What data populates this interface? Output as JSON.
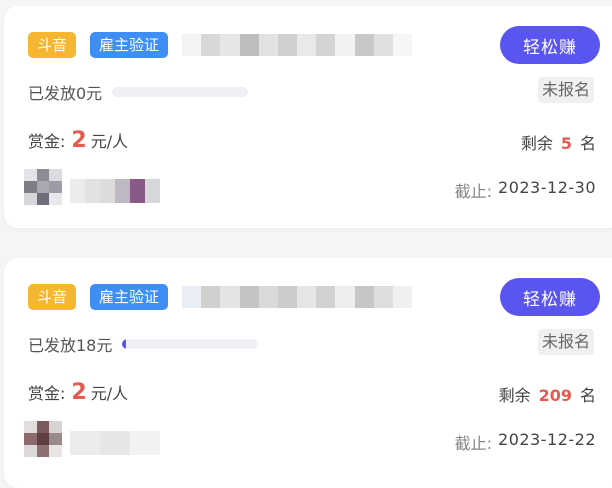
{
  "tasks": [
    {
      "platform_tag": "斗音",
      "verified_tag": "雇主验证",
      "action_label": "轻松赚",
      "issued_text": "已发放0元",
      "progress_fraction": 0.0,
      "status": "未报名",
      "reward_label": "赏金:",
      "reward_amount": "2",
      "reward_unit": "元/人",
      "remaining_label": "剩余",
      "remaining_count": "5",
      "remaining_unit": "名",
      "deadline_label": "截止:",
      "deadline_date": "2023-12-30"
    },
    {
      "platform_tag": "斗音",
      "verified_tag": "雇主验证",
      "action_label": "轻松赚",
      "issued_text": "已发放18元",
      "progress_fraction": 0.02,
      "status": "未报名",
      "reward_label": "赏金:",
      "reward_amount": "2",
      "reward_unit": "元/人",
      "remaining_label": "剩余",
      "remaining_count": "209",
      "remaining_unit": "名",
      "deadline_label": "截止:",
      "deadline_date": "2023-12-22"
    }
  ],
  "colors": {
    "accent": "#5b55f0",
    "platform_tag": "#f5b731",
    "verified_tag": "#3f8ef5",
    "highlight": "#e45b50"
  }
}
